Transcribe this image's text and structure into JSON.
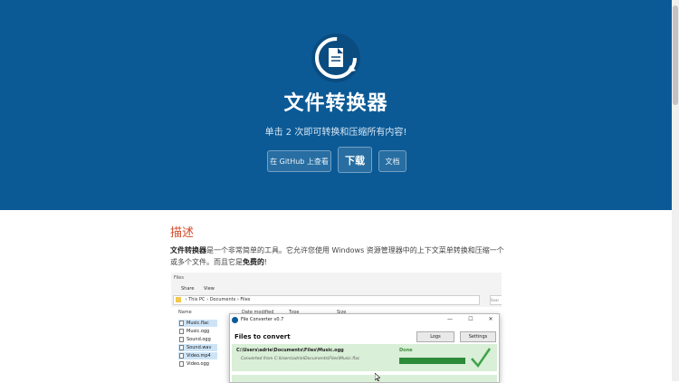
{
  "hero": {
    "title": "文件转换器",
    "subtitle": "单击 2 次即可转换和压缩所有内容!",
    "buttons": {
      "github": "在 GitHub 上查看",
      "download": "下载",
      "docs": "文档"
    },
    "bg_color": "#0b5a96"
  },
  "description": {
    "heading": "描述",
    "bold_name": "文件转换器",
    "text_1": "是一个非常简单的工具。它允许您使用 Windows 资源管理器中的上下文菜单转换和压缩一个或多个文件。而且它是",
    "bold_free": "免费的",
    "text_2": "!"
  },
  "explorer": {
    "title": "Files",
    "menu": [
      "Share",
      "View"
    ],
    "address": [
      "This PC",
      "Documents",
      "Files"
    ],
    "search_placeholder": "Sear",
    "columns": [
      "Name",
      "Date modified",
      "Type",
      "Size"
    ],
    "files": [
      {
        "name": "Music.flac",
        "selected": true
      },
      {
        "name": "Music.ogg",
        "selected": false
      },
      {
        "name": "Sound.ogg",
        "selected": false
      },
      {
        "name": "Sound.wav",
        "selected": true
      },
      {
        "name": "Video.mp4",
        "selected": true
      },
      {
        "name": "Video.ogg",
        "selected": false
      }
    ]
  },
  "converter": {
    "title": "File Converter v0.7",
    "heading": "Files to convert",
    "logs_label": "Logs",
    "settings_label": "Settings",
    "rows": [
      {
        "path": "C:\\Users\\adrie\\Documents\\Files\\Music.ogg",
        "converted_from": "Converted from C:\\Users\\adrie\\Documents\\Files\\Music.flac",
        "status": "Done",
        "progress": 1.0
      }
    ]
  }
}
